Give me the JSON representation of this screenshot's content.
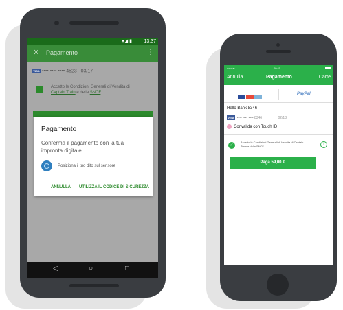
{
  "android": {
    "status_time": "13:37",
    "status_icons": "▾◢ ▮",
    "appbar": {
      "close": "✕",
      "title": "Pagamento",
      "menu": "⋮"
    },
    "card": {
      "number": "•••• •••• •••• 4523",
      "expiry": "03/17",
      "brand": "VISA"
    },
    "terms": {
      "text": "Accetto le Condizioni Generali di Vendita di",
      "link1": "Captain Train",
      "mid": "e della",
      "link2": "SNCF",
      "end": "."
    },
    "dialog": {
      "title": "Pagamento",
      "message": "Conferma il pagamento con la tua impronta digitale.",
      "fingerprint_hint": "Posiziona il tuo dito sul sensore",
      "cancel": "ANNULLA",
      "security_code": "UTILIZZA IL CODICE DI SICUREZZA"
    },
    "nav": {
      "back": "◁",
      "home": "○",
      "recents": "□"
    }
  },
  "iphone": {
    "status": {
      "carrier": "••••• ᯤ",
      "time": "09:41"
    },
    "nav": {
      "left": "Annulla",
      "title": "Pagamento",
      "right": "Carte"
    },
    "paypal": "PayPal",
    "bank": "Hello Bank 8346",
    "card": {
      "brand": "VISA",
      "number": "•••• •••• •••• 8346",
      "expiry": "02/18"
    },
    "touch_id": "Convalida con Touch ID",
    "terms": "Accetto le Condizioni Generali di Vendita di Captain Train e della SNCF.",
    "info": "i",
    "pay_button": "Paga 59,00 €"
  },
  "colors": {
    "green": "#2d8a2d",
    "ios_green": "#2bb04a",
    "phone_body": "#3a3d41"
  }
}
